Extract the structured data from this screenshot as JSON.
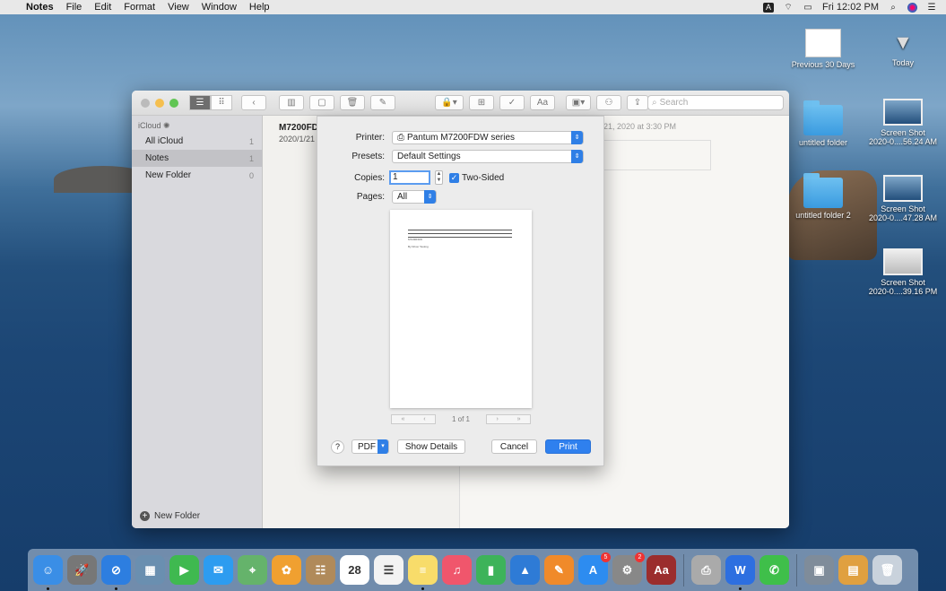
{
  "menubar": {
    "app": "Notes",
    "items": [
      "File",
      "Edit",
      "Format",
      "View",
      "Window",
      "Help"
    ],
    "input_source": "A",
    "clock": "Fri 12:02 PM"
  },
  "desktop": {
    "icons": [
      {
        "label1": "Previous 30 Days",
        "label2": "",
        "kind": "thumb"
      },
      {
        "label1": "Today",
        "label2": "",
        "kind": "download"
      },
      {
        "label1": "untitled folder",
        "label2": "",
        "kind": "folder"
      },
      {
        "label1": "Screen Shot",
        "label2": "2020-0....56.24 AM",
        "kind": "shot"
      },
      {
        "label1": "untitled folder 2",
        "label2": "",
        "kind": "folder"
      },
      {
        "label1": "Screen Shot",
        "label2": "2020-0....47.28 AM",
        "kind": "shot"
      },
      {
        "label1": "Screen Shot",
        "label2": "2020-0....39.16 PM",
        "kind": "shot"
      }
    ]
  },
  "notes": {
    "search_placeholder": "Search",
    "sidebar_header": "iCloud",
    "folders": [
      {
        "name": "All iCloud",
        "count": "1"
      },
      {
        "name": "Notes",
        "count": "1"
      },
      {
        "name": "New Folder",
        "count": "0"
      }
    ],
    "new_folder": "New Folder",
    "note_title": "M7200FD",
    "note_date": "2020/1/21",
    "editor_stamp": "21, 2020 at 3:30 PM"
  },
  "print": {
    "printer_label": "Printer:",
    "printer_value": "Pantum M7200FDW series",
    "presets_label": "Presets:",
    "presets_value": "Default Settings",
    "copies_label": "Copies:",
    "copies_value": "1",
    "two_sided_label": "Two-Sided",
    "two_sided_checked": true,
    "pages_label": "Pages:",
    "pages_value": "All",
    "page_indicator": "1 of 1",
    "preview_text1": "M7200FDW",
    "preview_text2": "By Driver Testing",
    "help": "?",
    "pdf": "PDF",
    "show_details": "Show Details",
    "cancel": "Cancel",
    "print_btn": "Print"
  },
  "dock": {
    "apps": [
      {
        "name": "finder",
        "glyph": "☺",
        "color": "#3a8ee6",
        "running": true,
        "badge": ""
      },
      {
        "name": "launchpad",
        "glyph": "🚀",
        "color": "#777",
        "running": false,
        "badge": ""
      },
      {
        "name": "safari",
        "glyph": "⊘",
        "color": "#2d7ee0",
        "running": true,
        "badge": ""
      },
      {
        "name": "preview",
        "glyph": "▦",
        "color": "#6a8fb0",
        "running": false,
        "badge": ""
      },
      {
        "name": "facetime",
        "glyph": "▶",
        "color": "#3fb950",
        "running": false,
        "badge": ""
      },
      {
        "name": "messages",
        "glyph": "✉",
        "color": "#2d9cf0",
        "running": false,
        "badge": ""
      },
      {
        "name": "maps",
        "glyph": "⌖",
        "color": "#65b36b",
        "running": false,
        "badge": ""
      },
      {
        "name": "photos",
        "glyph": "✿",
        "color": "#f0a030",
        "running": false,
        "badge": ""
      },
      {
        "name": "contacts",
        "glyph": "☷",
        "color": "#b08a5a",
        "running": false,
        "badge": ""
      },
      {
        "name": "calendar",
        "glyph": "28",
        "color": "#ffffff",
        "running": false,
        "badge": ""
      },
      {
        "name": "reminders",
        "glyph": "☰",
        "color": "#f3f3f3",
        "running": false,
        "badge": ""
      },
      {
        "name": "notes",
        "glyph": "≡",
        "color": "#f8dc6a",
        "running": true,
        "badge": ""
      },
      {
        "name": "music",
        "glyph": "♫",
        "color": "#f0566c",
        "running": false,
        "badge": ""
      },
      {
        "name": "numbers",
        "glyph": "▮",
        "color": "#3db35a",
        "running": false,
        "badge": ""
      },
      {
        "name": "keynote",
        "glyph": "▲",
        "color": "#2e7bd6",
        "running": false,
        "badge": ""
      },
      {
        "name": "pages",
        "glyph": "✎",
        "color": "#f08a2a",
        "running": false,
        "badge": ""
      },
      {
        "name": "app-store",
        "glyph": "A",
        "color": "#2d8cf0",
        "running": false,
        "badge": "5"
      },
      {
        "name": "system-preferences",
        "glyph": "⚙",
        "color": "#888",
        "running": false,
        "badge": "2"
      },
      {
        "name": "dictionary",
        "glyph": "Aa",
        "color": "#9b2d2d",
        "running": false,
        "badge": ""
      },
      {
        "name": "printer-queue",
        "glyph": "⎙",
        "color": "#aaa",
        "running": false,
        "badge": ""
      },
      {
        "name": "wps",
        "glyph": "W",
        "color": "#2d6fe0",
        "running": true,
        "badge": ""
      },
      {
        "name": "wechat",
        "glyph": "✆",
        "color": "#3fbf4a",
        "running": false,
        "badge": ""
      },
      {
        "name": "image-capture",
        "glyph": "▣",
        "color": "#7f8c9a",
        "running": false,
        "badge": ""
      },
      {
        "name": "archive",
        "glyph": "▤",
        "color": "#e0a040",
        "running": false,
        "badge": ""
      },
      {
        "name": "trash",
        "glyph": "🗑",
        "color": "#c9d2dc",
        "running": false,
        "badge": ""
      }
    ]
  }
}
